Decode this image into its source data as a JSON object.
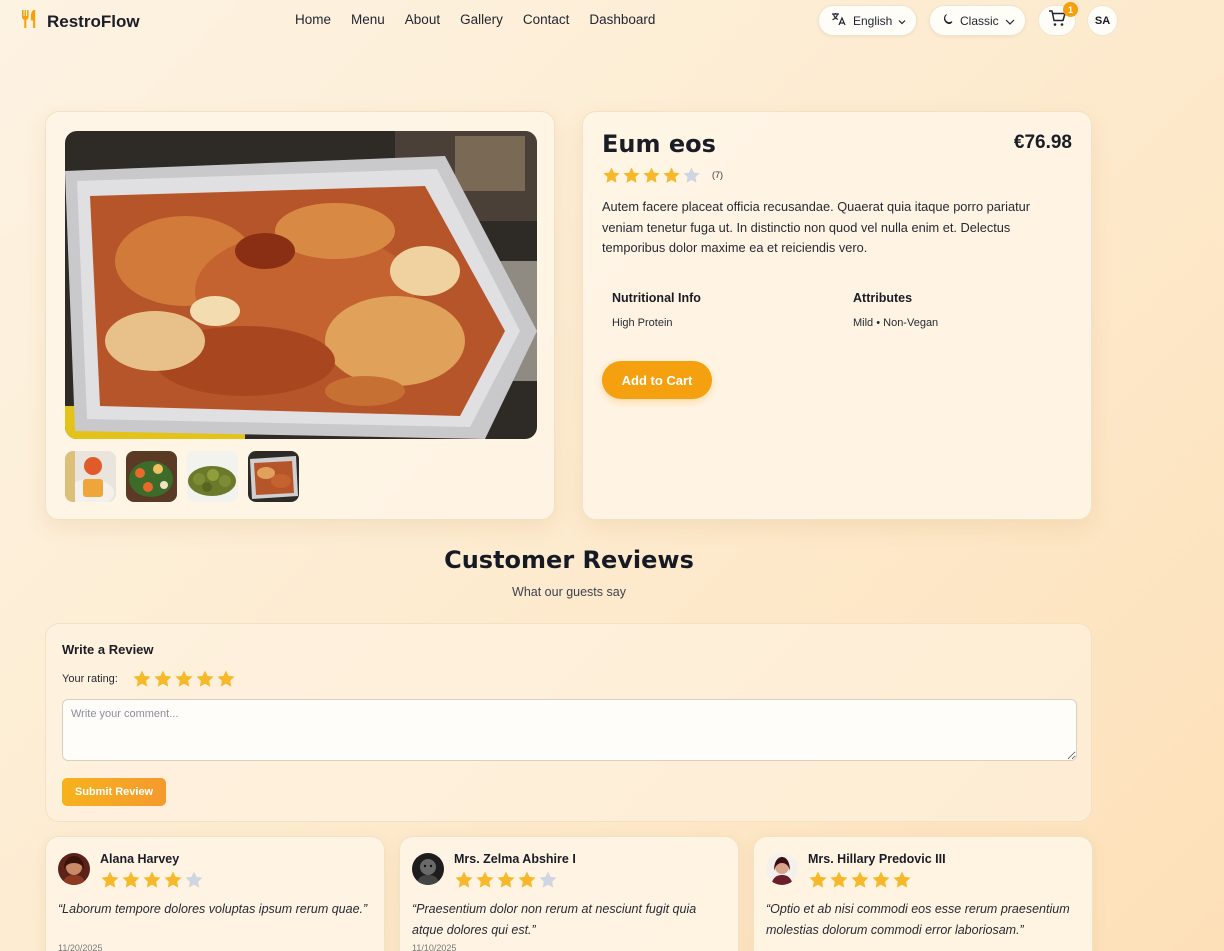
{
  "nav": {
    "brand": "RestroFlow",
    "links": [
      "Home",
      "Menu",
      "About",
      "Gallery",
      "Contact",
      "Dashboard"
    ],
    "language": "English",
    "theme": "Classic",
    "cart_count": "1",
    "user_initials": "SA"
  },
  "product": {
    "name": "Eum eos",
    "price": "€76.98",
    "rating": 4,
    "rating_count": "(7)",
    "description": "Autem facere placeat officia recusandae. Quaerat quia itaque porro pariatur veniam tenetur fuga ut. In distinctio non quod vel nulla enim et. Delectus temporibus dolor maxime ea et reiciendis vero.",
    "nutrition_title": "Nutritional Info",
    "nutrition_value": "High Protein",
    "attributes_title": "Attributes",
    "attributes_value": "Mild • Non-Vegan",
    "add_to_cart": "Add to Cart"
  },
  "reviews": {
    "heading": "Customer Reviews",
    "subheading": "What our guests say",
    "form": {
      "title": "Write a Review",
      "rating_label": "Your rating:",
      "rating": 5,
      "placeholder": "Write your comment...",
      "submit": "Submit Review"
    },
    "items": [
      {
        "name": "Alana Harvey",
        "rating": 4,
        "text": "“Laborum tempore dolores voluptas ipsum rerum quae.”",
        "date": "11/20/2025"
      },
      {
        "name": "Mrs. Zelma Abshire I",
        "rating": 4,
        "text": "“Praesentium dolor non rerum at nesciunt fugit quia atque dolores qui est.”",
        "date": "11/10/2025"
      },
      {
        "name": "Mrs. Hillary Predovic III",
        "rating": 5,
        "text": "“Optio et ab nisi commodi eos esse rerum praesentium molestias dolorum commodi error laboriosam.”",
        "date": ""
      }
    ]
  },
  "colors": {
    "accent": "#f5a00f",
    "star_filled": "#f5b92b",
    "star_empty": "#cfd5e1"
  }
}
